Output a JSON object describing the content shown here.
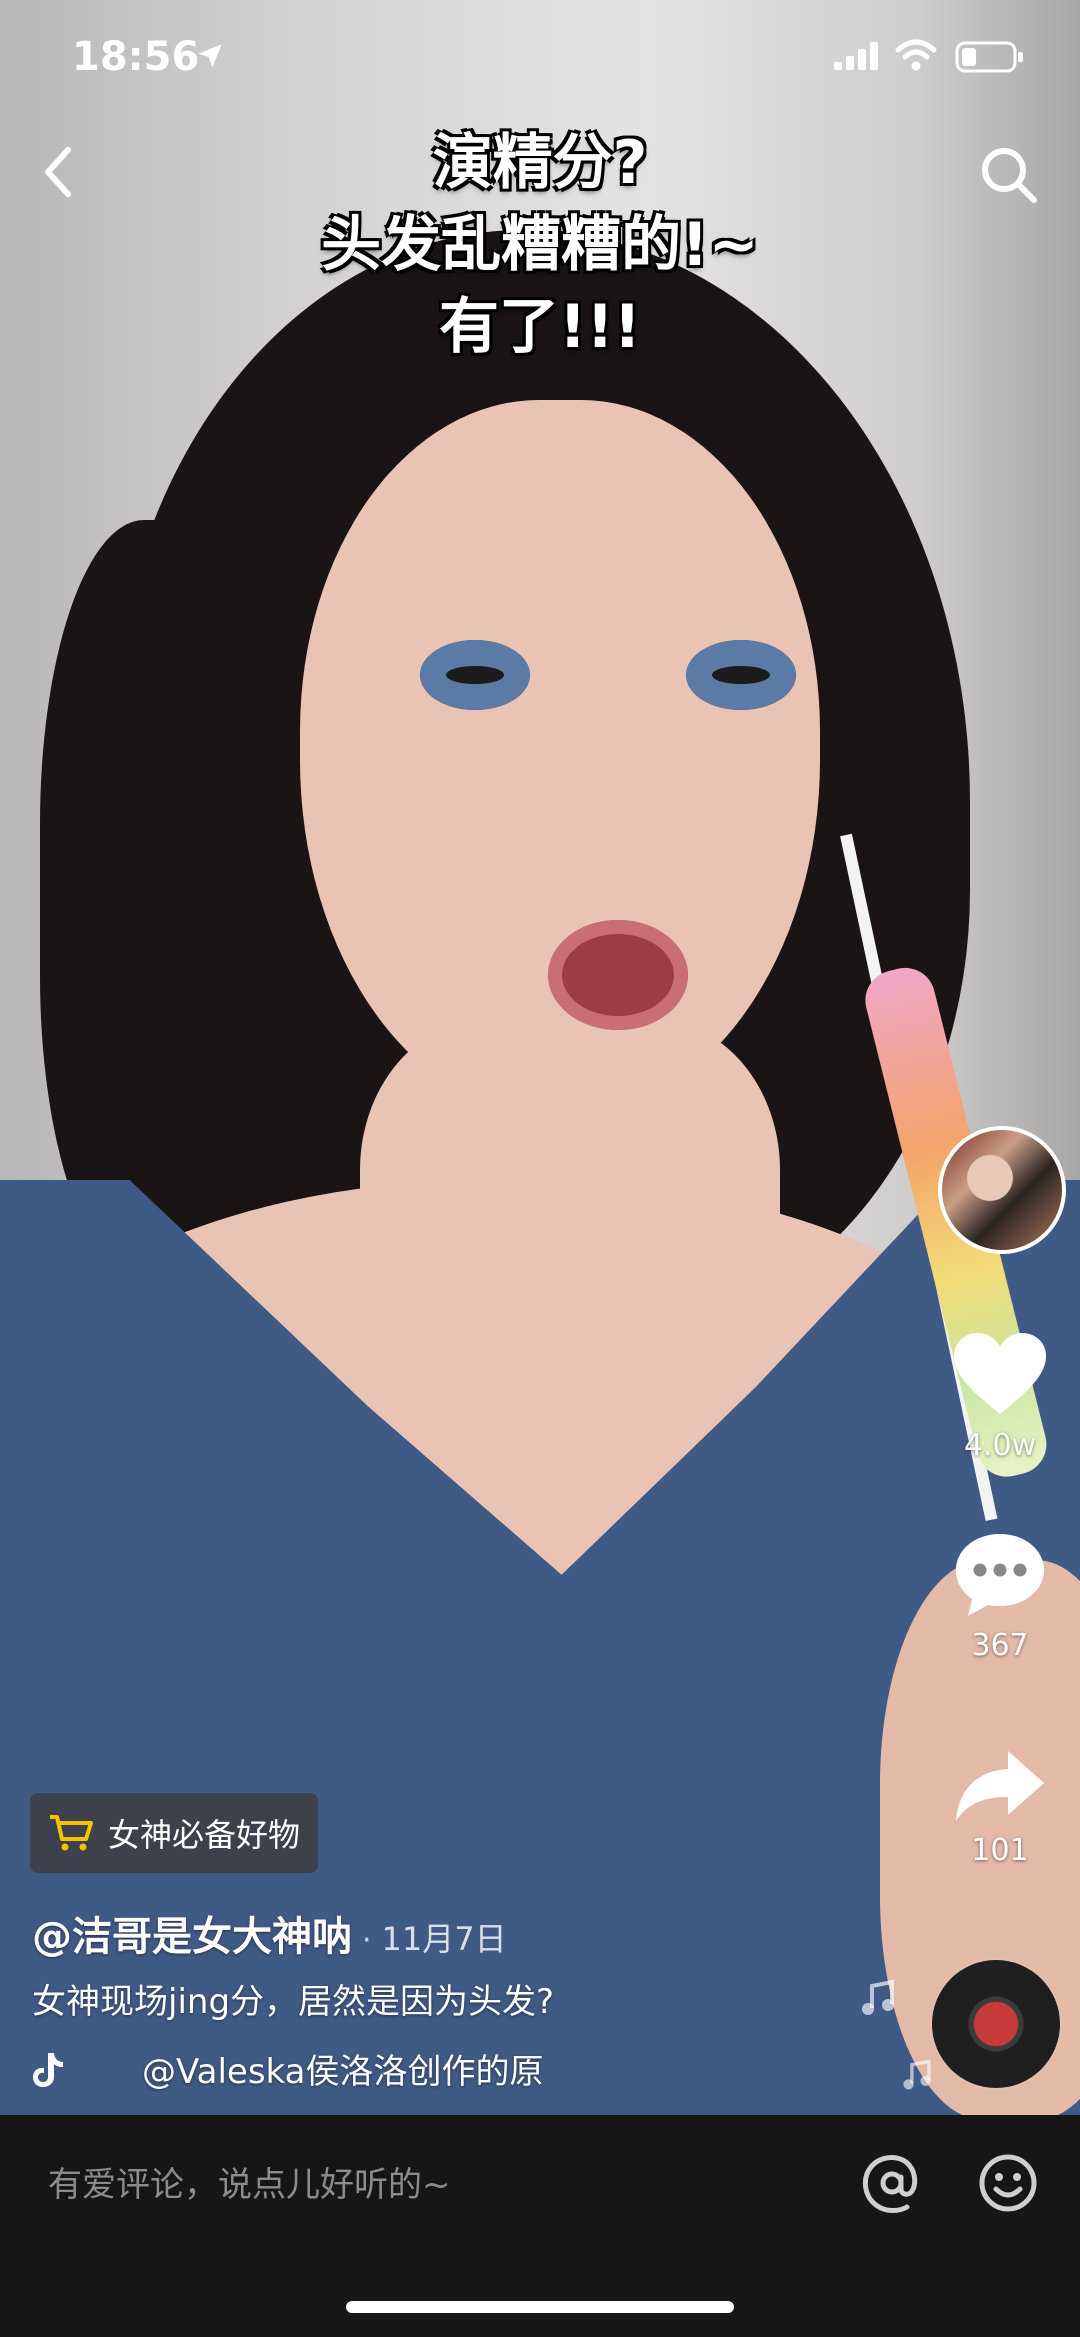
{
  "status_bar": {
    "time": "18:56"
  },
  "header": {
    "caption_lines": [
      "演精分?",
      "头发乱糟糟的!~",
      "有了!!!"
    ]
  },
  "actions": {
    "likes": "4.0w",
    "comments": "367",
    "shares": "101"
  },
  "shop_tag": {
    "label": "女神必备好物"
  },
  "post": {
    "author": "@洁哥是女大神呐",
    "separator": "·",
    "date": "11月7日",
    "description": "女神现场jing分，居然是因为头发?",
    "music": "@Valeska侯洛洛创作的原"
  },
  "comment_bar": {
    "placeholder": "有爱评论，说点儿好听的~"
  },
  "icons": {
    "back": "chevron-left-icon",
    "search": "search-icon",
    "like": "heart-icon",
    "comment": "comment-bubble-icon",
    "share": "share-arrow-icon",
    "cart": "cart-icon",
    "at": "at-sign-icon",
    "emoji": "smiley-icon"
  },
  "colors": {
    "shop_cart": "#f5c400",
    "comment_bar_bg": "#161616"
  }
}
